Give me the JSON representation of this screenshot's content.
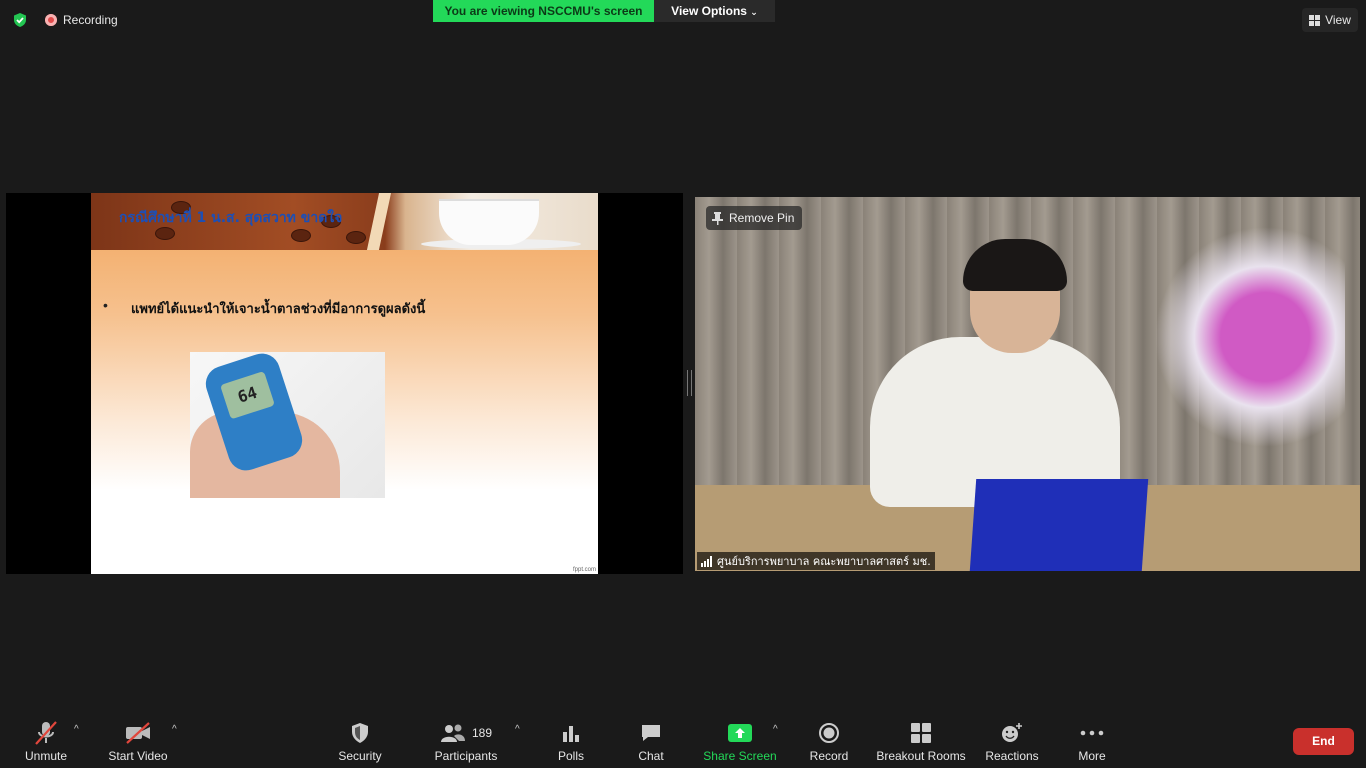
{
  "topbar": {
    "recording_label": "Recording",
    "viewing_banner": "You are viewing NSCCMU's screen",
    "view_options_label": "View Options",
    "view_label": "View",
    "accent_green": "#23d959"
  },
  "shared_slide": {
    "title": "กรณีศึกษาที่ 1 น.ส. สุดสวาท ขาดใจ",
    "bullet_text": "แพทย์ได้แนะนำให้เจาะน้ำตาลช่วงที่มีอาการดูผลดังนี้",
    "meter_reading": "64",
    "watermark": "fppt.com"
  },
  "video": {
    "remove_pin_label": "Remove Pin",
    "participant_name": "ศูนย์บริการพยาบาล คณะพยาบาลศาสตร์ มช."
  },
  "toolbar": {
    "unmute": "Unmute",
    "start_video": "Start Video",
    "security": "Security",
    "participants": "Participants",
    "participants_count": "189",
    "polls": "Polls",
    "chat": "Chat",
    "share_screen": "Share Screen",
    "record": "Record",
    "breakout_rooms": "Breakout Rooms",
    "reactions": "Reactions",
    "more": "More",
    "end": "End",
    "end_color": "#c9302c"
  }
}
